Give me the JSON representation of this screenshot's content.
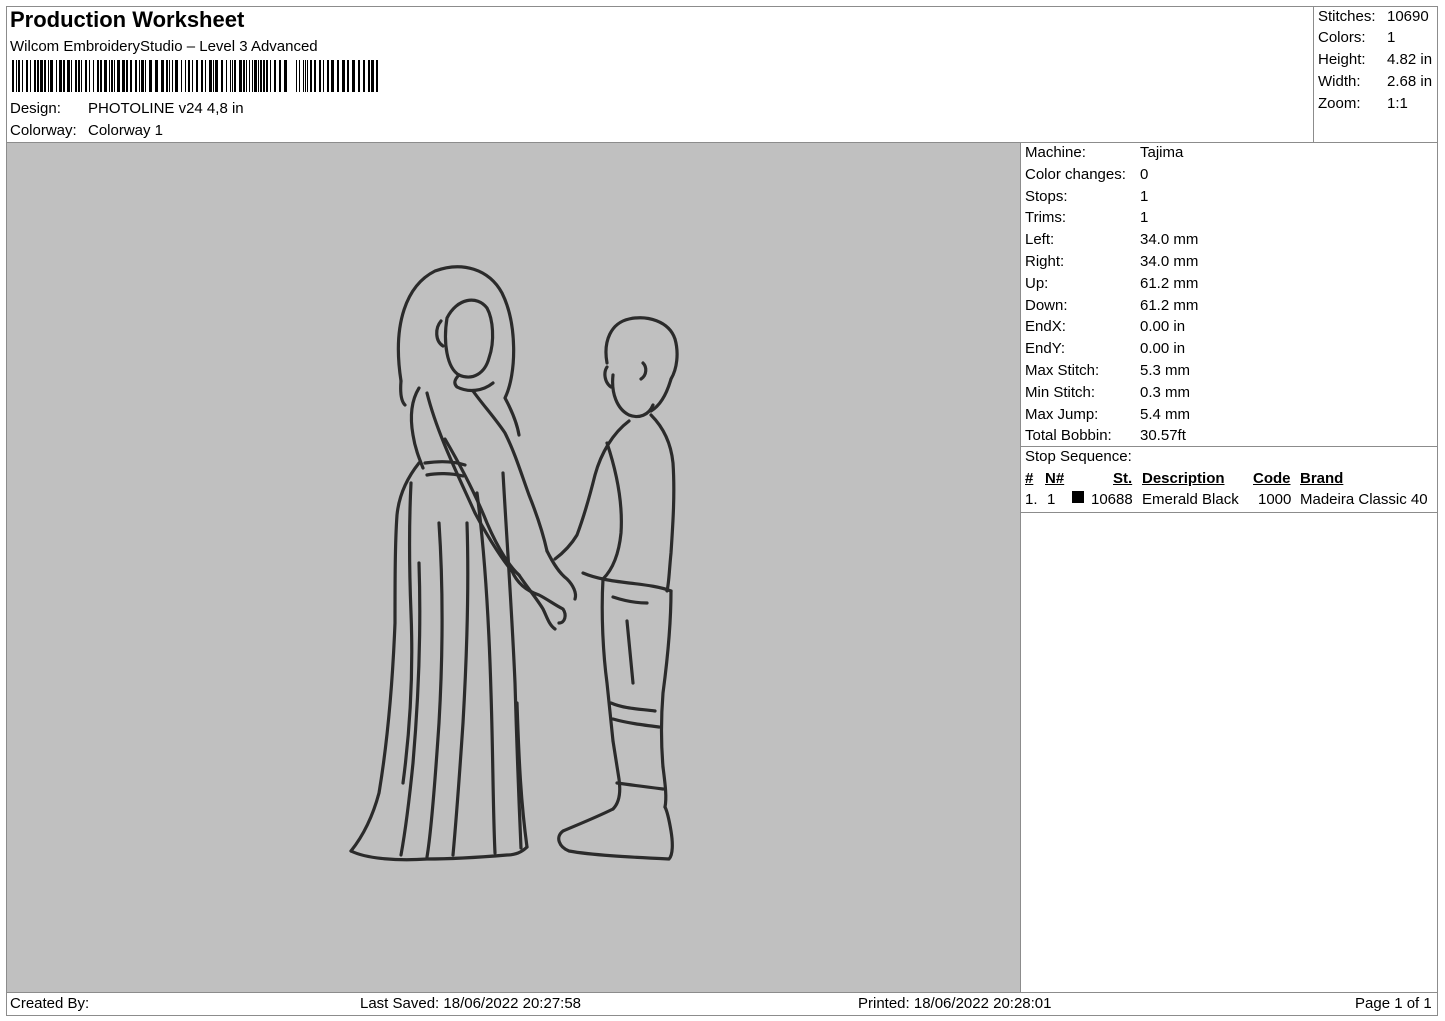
{
  "header": {
    "title": "Production Worksheet",
    "software": "Wilcom EmbroideryStudio – Level 3 Advanced",
    "design_label": "Design:",
    "design_value": "PHOTOLINE v24 4,8 in",
    "colorway_label": "Colorway:",
    "colorway_value": "Colorway 1"
  },
  "summary": [
    {
      "label": "Stitches:",
      "value": "10690"
    },
    {
      "label": "Colors:",
      "value": "1"
    },
    {
      "label": "Height:",
      "value": "4.82 in"
    },
    {
      "label": "Width:",
      "value": "2.68 in"
    },
    {
      "label": "Zoom:",
      "value": "1:1"
    }
  ],
  "machine_stats": [
    {
      "label": "Machine:",
      "value": "Tajima"
    },
    {
      "label": "Color changes:",
      "value": "0"
    },
    {
      "label": "Stops:",
      "value": "1"
    },
    {
      "label": "Trims:",
      "value": "1"
    },
    {
      "label": "Left:",
      "value": "34.0 mm"
    },
    {
      "label": "Right:",
      "value": "34.0 mm"
    },
    {
      "label": "Up:",
      "value": "61.2 mm"
    },
    {
      "label": "Down:",
      "value": "61.2 mm"
    },
    {
      "label": "EndX:",
      "value": "0.00 in"
    },
    {
      "label": "EndY:",
      "value": "0.00 in"
    },
    {
      "label": "Max Stitch:",
      "value": "5.3 mm"
    },
    {
      "label": "Min Stitch:",
      "value": "0.3 mm"
    },
    {
      "label": "Max Jump:",
      "value": "5.4 mm"
    },
    {
      "label": "Total Bobbin:",
      "value": "30.57ft"
    }
  ],
  "stop_sequence": {
    "title": "Stop Sequence:",
    "columns": [
      "#",
      "N#",
      "St.",
      "Description",
      "Code",
      "Brand"
    ],
    "rows": [
      {
        "num": "1.",
        "n": "1",
        "swatch": "#000000",
        "st": "10688",
        "description": "Emerald Black",
        "code": "1000",
        "brand": "Madeira Classic 40"
      }
    ]
  },
  "footer": {
    "created_by": "Created By:",
    "last_saved": "Last Saved: 18/06/2022 20:27:58",
    "printed": "Printed: 18/06/2022 20:28:01",
    "page": "Page 1 of 1"
  },
  "colors": {
    "canvas_bg": "#c0c0c0",
    "thread": "#2b2b2b",
    "border": "#8c8c8c"
  }
}
